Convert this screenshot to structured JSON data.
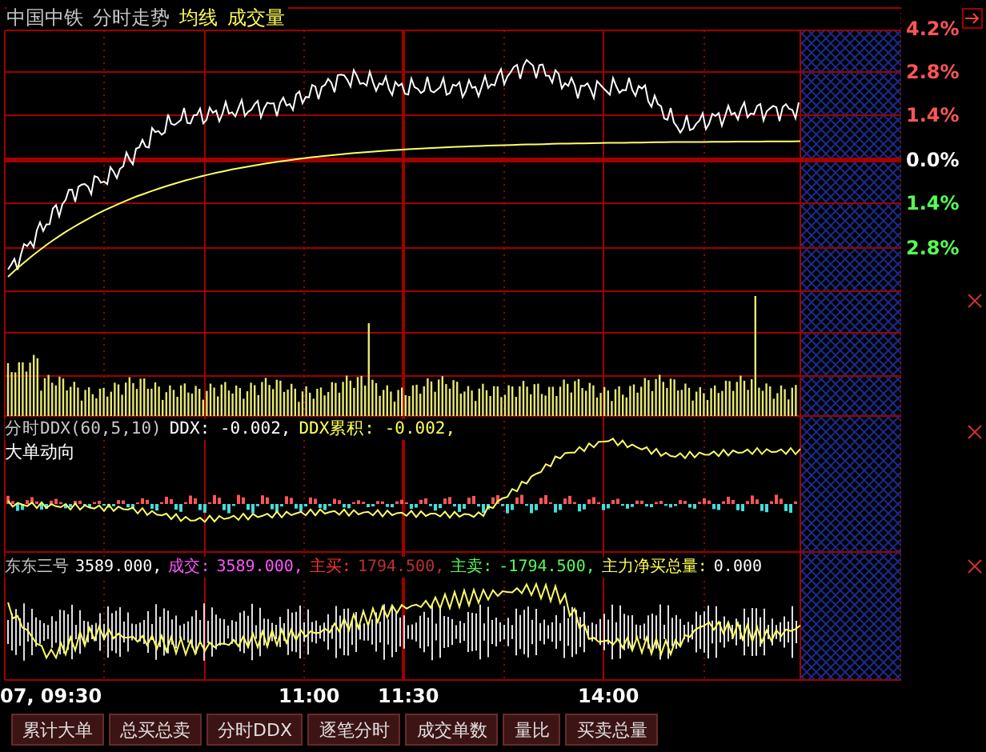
{
  "title_items": [
    {
      "text": "中国中铁",
      "color": "#c8c8c8"
    },
    {
      "text": "分时走势",
      "color": "#c8c8c8"
    },
    {
      "text": "均线",
      "color": "#ffff55"
    },
    {
      "text": "成交量",
      "color": "#ffff55"
    }
  ],
  "price_axis": [
    {
      "label": "4.2%",
      "color": "#ff5555"
    },
    {
      "label": "2.8%",
      "color": "#ff5555"
    },
    {
      "label": "1.4%",
      "color": "#ff5555"
    },
    {
      "label": "0.0%",
      "color": "#ffffff"
    },
    {
      "label": "1.4%",
      "color": "#55ff55"
    },
    {
      "label": "2.8%",
      "color": "#55ff55"
    }
  ],
  "ddx_panel": {
    "header": [
      {
        "text": "分时DDX(60,5,10)",
        "color": "#c8c8c8"
      },
      {
        "text": "DDX: -0.002,",
        "color": "#ffffff"
      },
      {
        "text": "DDX累积: -0.002,",
        "color": "#ffff55"
      }
    ],
    "subtitle": "大单动向"
  },
  "flow_panel": {
    "header": [
      {
        "text": "东东三号",
        "color": "#c8c8c8"
      },
      {
        "text": "3589.000,",
        "color": "#ffffff"
      },
      {
        "text": "成交:",
        "color": "#ff55ff"
      },
      {
        "text": "3589.000,",
        "color": "#ff55ff"
      },
      {
        "text": "主买:",
        "color": "#ff3333"
      },
      {
        "text": "1794.500,",
        "color": "#c03030"
      },
      {
        "text": "主卖:",
        "color": "#55ff55"
      },
      {
        "text": "-1794.500,",
        "color": "#55ff55"
      },
      {
        "text": "主力净买总量:",
        "color": "#ffff55"
      },
      {
        "text": "0.000",
        "color": "#ffffff"
      }
    ]
  },
  "time_labels": [
    "07, 09:30",
    "11:00",
    "11:30",
    "14:00"
  ],
  "tabs": [
    {
      "label": "累计大单",
      "selected": false
    },
    {
      "label": "总买总卖",
      "selected": false
    },
    {
      "label": "分时DDX",
      "selected": false
    },
    {
      "label": "逐笔分时",
      "selected": false
    },
    {
      "label": "成交单数",
      "selected": false
    },
    {
      "label": "量比",
      "selected": false
    },
    {
      "label": "买卖总量",
      "selected": false
    }
  ]
}
